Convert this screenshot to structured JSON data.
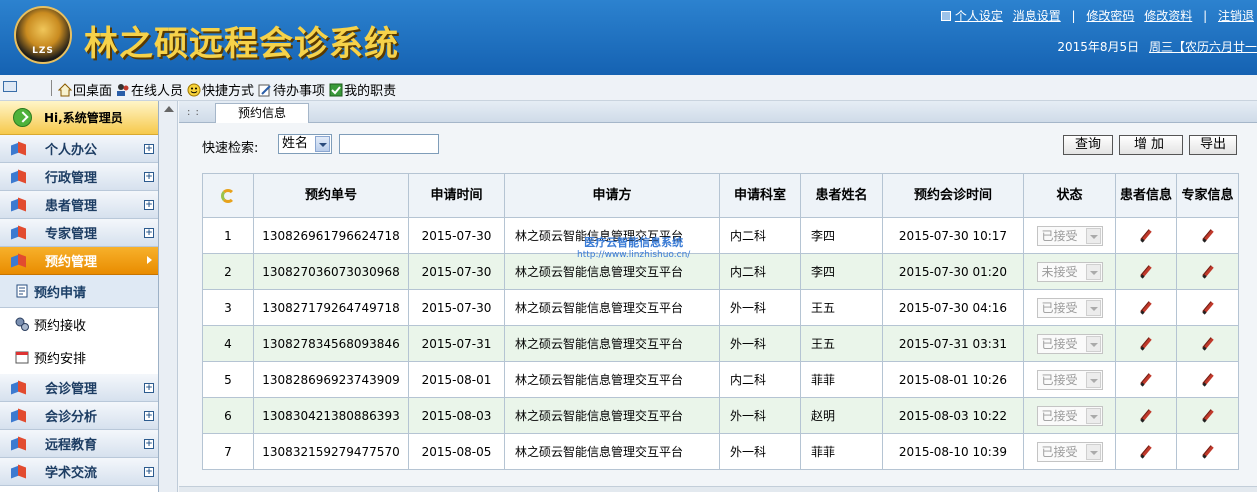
{
  "header": {
    "logo_text": "LZS",
    "title": "林之硕远程会诊系统",
    "links": [
      "个人设定",
      "消息设置",
      "修改密码",
      "修改资料",
      "注销退"
    ],
    "date": "2015年8月5日",
    "lunar_link": "周三【农历六月廿一"
  },
  "toolbar": {
    "items": [
      "回桌面",
      "在线人员",
      "快捷方式",
      "待办事项",
      "我的职责"
    ]
  },
  "sidebar": {
    "greeting": "Hi,系统管理员",
    "menu_before": [
      "个人办公",
      "行政管理",
      "患者管理",
      "专家管理"
    ],
    "active_menu": "预约管理",
    "sub_items": [
      "预约申请",
      "预约接收",
      "预约安排"
    ],
    "menu_after": [
      "会诊管理",
      "会诊分析",
      "远程教育",
      "学术交流"
    ]
  },
  "content": {
    "tab_label": "预约信息",
    "search_label": "快速检索:",
    "search_field_value": "姓名",
    "search_input_value": "",
    "buttons": {
      "query": "查询",
      "add": "增加",
      "export": "导出"
    },
    "columns": [
      "预约单号",
      "申请时间",
      "申请方",
      "申请科室",
      "患者姓名",
      "预约会诊时间",
      "状态",
      "患者信息",
      "专家信息"
    ],
    "rows": [
      {
        "no": "1",
        "order": "130826961796624718",
        "apply_date": "2015-07-30",
        "applicant": "林之硕云智能信息管理交互平台",
        "dept": "内二科",
        "patient": "李四",
        "time": "2015-07-30 10:17",
        "status": "已接受"
      },
      {
        "no": "2",
        "order": "130827036073030968",
        "apply_date": "2015-07-30",
        "applicant": "林之硕云智能信息管理交互平台",
        "dept": "内二科",
        "patient": "李四",
        "time": "2015-07-30 01:20",
        "status": "未接受"
      },
      {
        "no": "3",
        "order": "130827179264749718",
        "apply_date": "2015-07-30",
        "applicant": "林之硕云智能信息管理交互平台",
        "dept": "外一科",
        "patient": "王五",
        "time": "2015-07-30 04:16",
        "status": "已接受"
      },
      {
        "no": "4",
        "order": "130827834568093846",
        "apply_date": "2015-07-31",
        "applicant": "林之硕云智能信息管理交互平台",
        "dept": "外一科",
        "patient": "王五",
        "time": "2015-07-31 03:31",
        "status": "已接受"
      },
      {
        "no": "5",
        "order": "130828696923743909",
        "apply_date": "2015-08-01",
        "applicant": "林之硕云智能信息管理交互平台",
        "dept": "内二科",
        "patient": "菲菲",
        "time": "2015-08-01 10:26",
        "status": "已接受"
      },
      {
        "no": "6",
        "order": "130830421380886393",
        "apply_date": "2015-08-03",
        "applicant": "林之硕云智能信息管理交互平台",
        "dept": "外一科",
        "patient": "赵明",
        "time": "2015-08-03 10:22",
        "status": "已接受"
      },
      {
        "no": "7",
        "order": "130832159279477570",
        "apply_date": "2015-08-05",
        "applicant": "林之硕云智能信息管理交互平台",
        "dept": "外一科",
        "patient": "菲菲",
        "time": "2015-08-10 10:39",
        "status": "已接受"
      }
    ],
    "watermark": {
      "line1": "医疗云智能信息系统",
      "line2": "http://www.linzhishuo.cn/"
    }
  },
  "colors": {
    "header_bg": "#1b6fbf",
    "title": "#f6d24a",
    "active_menu": "#f0a01a",
    "alt_row": "#eaf5ea"
  }
}
